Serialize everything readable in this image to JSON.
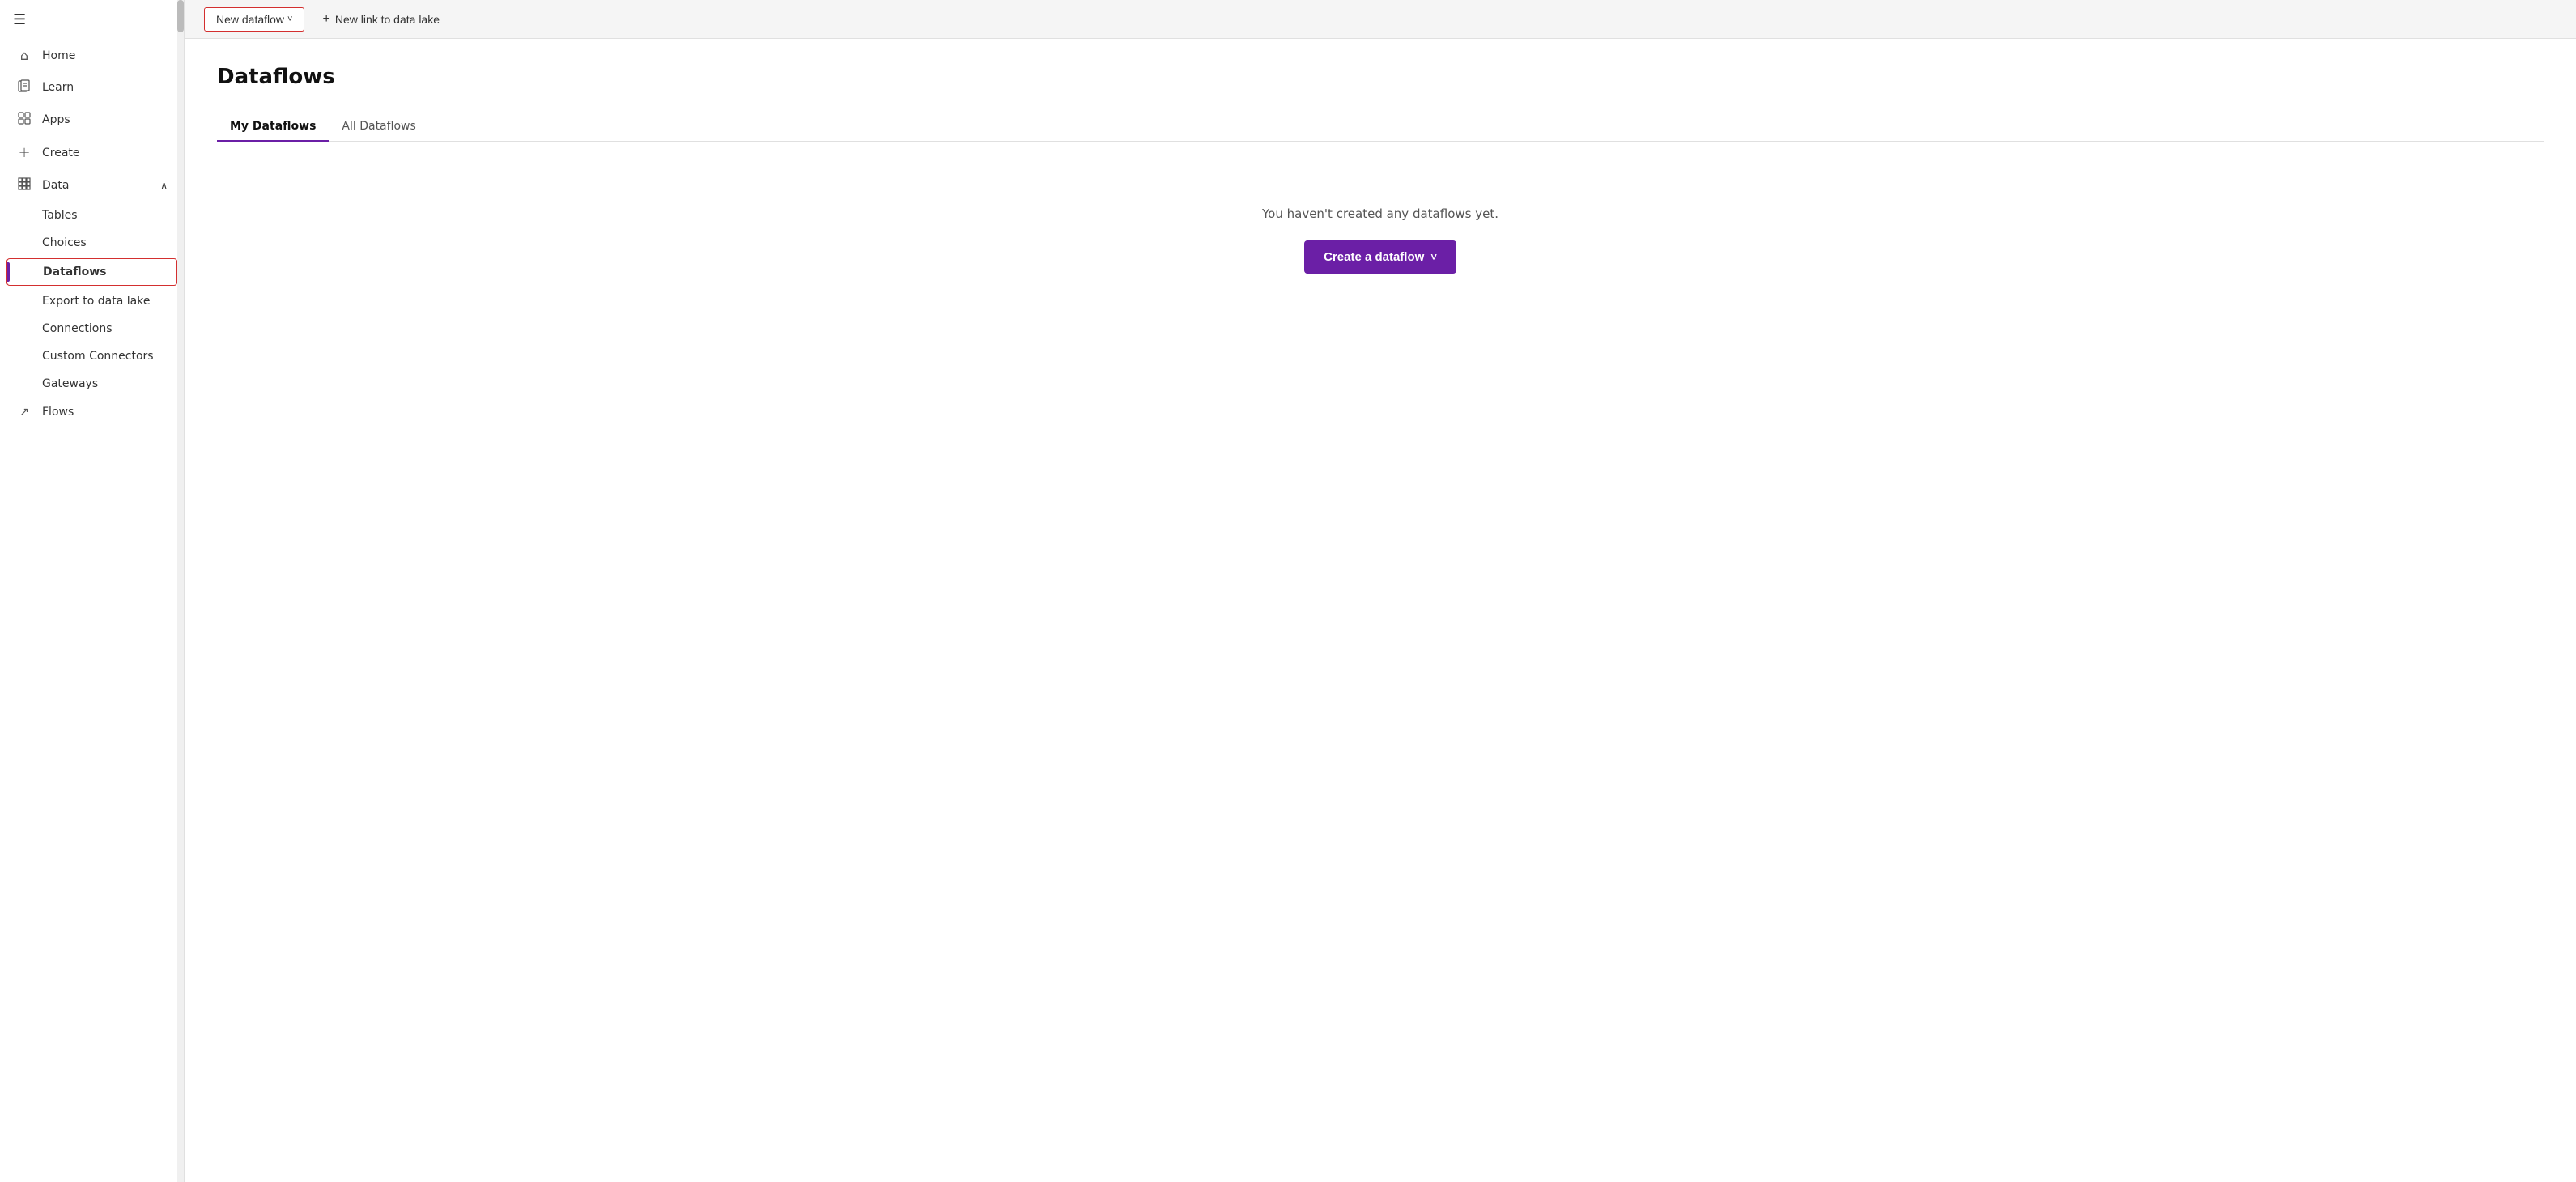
{
  "sidebar": {
    "hamburger_label": "☰",
    "items": [
      {
        "id": "home",
        "label": "Home",
        "icon": "⌂"
      },
      {
        "id": "learn",
        "label": "Learn",
        "icon": "📖"
      },
      {
        "id": "apps",
        "label": "Apps",
        "icon": "⊞"
      },
      {
        "id": "create",
        "label": "Create",
        "icon": "+"
      }
    ],
    "data_section": {
      "label": "Data",
      "icon": "⊞",
      "chevron": "∧",
      "children": [
        {
          "id": "tables",
          "label": "Tables"
        },
        {
          "id": "choices",
          "label": "Choices"
        },
        {
          "id": "dataflows",
          "label": "Dataflows",
          "active": true,
          "highlighted": true
        },
        {
          "id": "export",
          "label": "Export to data lake"
        },
        {
          "id": "connections",
          "label": "Connections"
        },
        {
          "id": "custom-connectors",
          "label": "Custom Connectors"
        },
        {
          "id": "gateways",
          "label": "Gateways"
        }
      ]
    },
    "flows": {
      "label": "Flows",
      "icon": "↗"
    }
  },
  "toolbar": {
    "new_dataflow_label": "New dataflow",
    "new_dataflow_chevron": "˅",
    "new_link_label": "New link to data lake",
    "new_link_icon": "+"
  },
  "main": {
    "page_title": "Dataflows",
    "tabs": [
      {
        "id": "my-dataflows",
        "label": "My Dataflows",
        "active": true
      },
      {
        "id": "all-dataflows",
        "label": "All Dataflows",
        "active": false
      }
    ],
    "empty_state": {
      "message": "You haven't created any dataflows yet.",
      "create_btn_label": "Create a dataflow",
      "create_btn_chevron": "˅"
    }
  }
}
